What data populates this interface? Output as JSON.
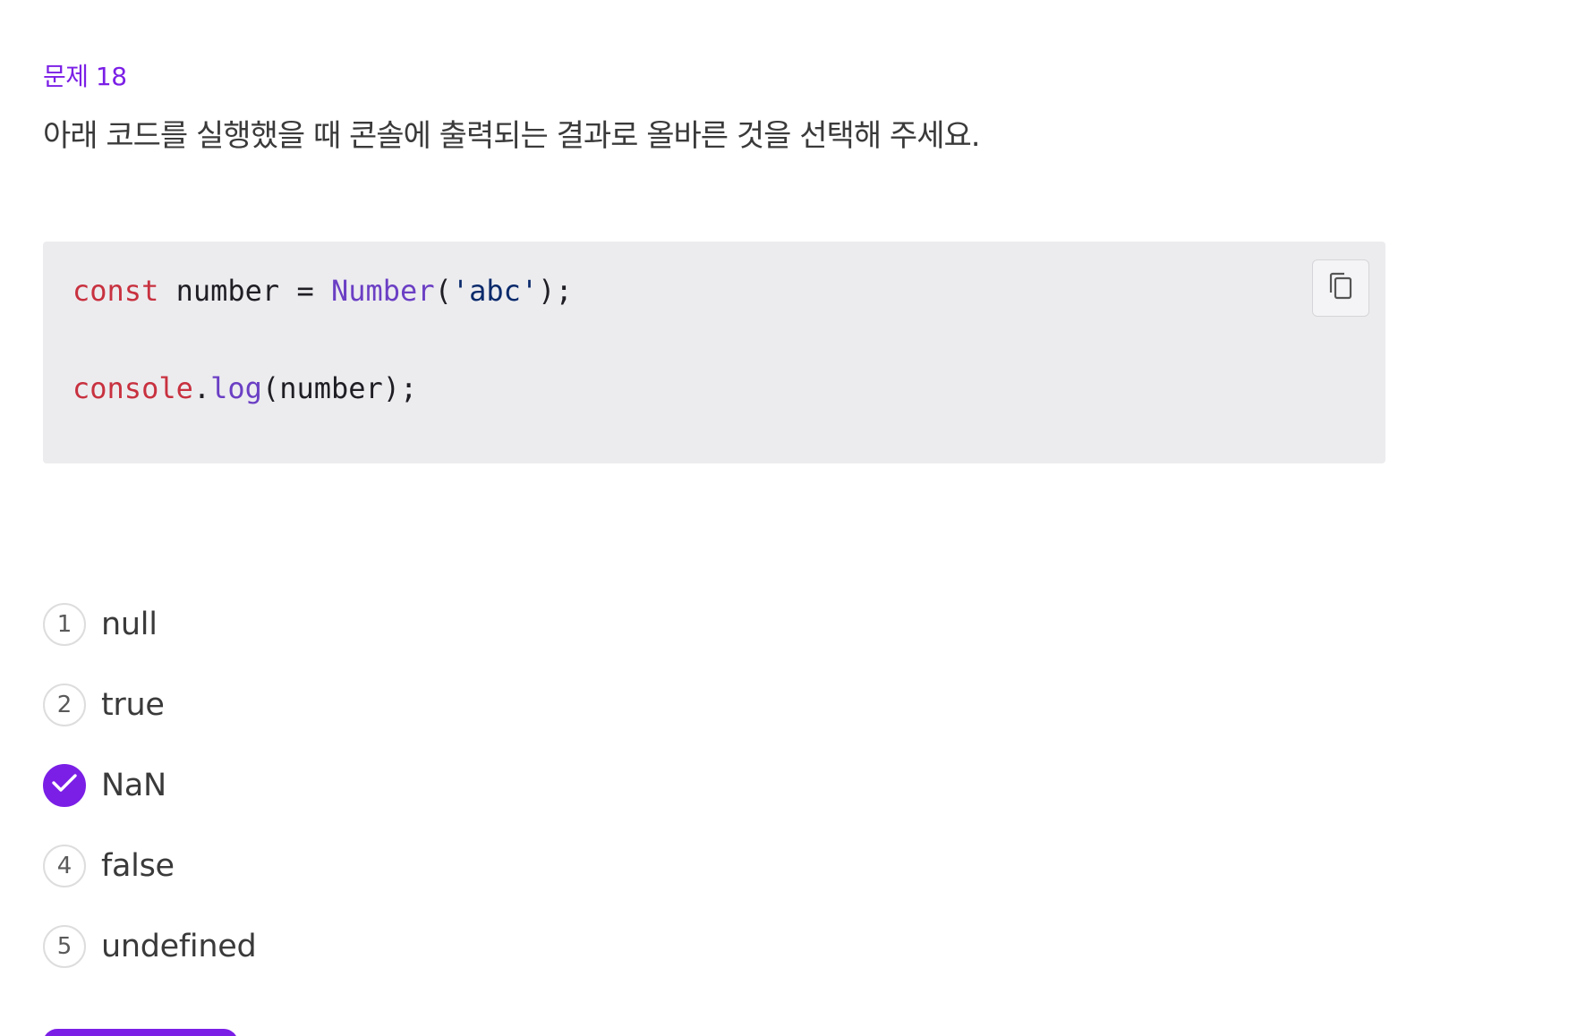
{
  "question": {
    "number_label": "문제 18",
    "text": "아래 코드를 실행했을 때 콘솔에 출력되는 결과로 올바른 것을 선택해 주세요."
  },
  "code": {
    "line1": {
      "keyword": "const",
      "space1": " ",
      "ident": "number",
      "op": " = ",
      "fn": "Number",
      "open": "(",
      "str": "'abc'",
      "close": ");"
    },
    "line2": {
      "obj": "console",
      "dot": ".",
      "method": "log",
      "args": "(number);"
    },
    "copy_icon": "copy-icon"
  },
  "options": [
    {
      "index": "1",
      "label": "null",
      "selected": false
    },
    {
      "index": "2",
      "label": "true",
      "selected": false
    },
    {
      "index": "3",
      "label": "NaN",
      "selected": true
    },
    {
      "index": "4",
      "label": "false",
      "selected": false
    },
    {
      "index": "5",
      "label": "undefined",
      "selected": false
    }
  ],
  "colors": {
    "accent": "#7b1fe6",
    "code_background": "#ececef",
    "keyword": "#c8313f",
    "function": "#6b3fc4",
    "string": "#0a2a6b"
  }
}
